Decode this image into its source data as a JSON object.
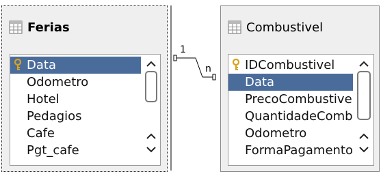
{
  "relation": {
    "cardinality_left": "1",
    "cardinality_right": "n"
  },
  "tables": [
    {
      "name": "Ferias",
      "icon": "table-icon",
      "selected_window": true,
      "fields": [
        {
          "name": "Data",
          "primary_key": true,
          "selected": true
        },
        {
          "name": "Odometro",
          "primary_key": false,
          "selected": false
        },
        {
          "name": "Hotel",
          "primary_key": false,
          "selected": false
        },
        {
          "name": "Pedagios",
          "primary_key": false,
          "selected": false
        },
        {
          "name": "Cafe",
          "primary_key": false,
          "selected": false
        },
        {
          "name": "Pgt_cafe",
          "primary_key": false,
          "selected": false
        }
      ]
    },
    {
      "name": "Combustivel",
      "icon": "table-icon",
      "selected_window": false,
      "fields": [
        {
          "name": "IDCombustivel",
          "primary_key": true,
          "selected": false
        },
        {
          "name": "Data",
          "primary_key": false,
          "selected": true
        },
        {
          "name": "PrecoCombustivel",
          "primary_key": false,
          "selected": false
        },
        {
          "name": "QuantidadeCombustivel",
          "primary_key": false,
          "selected": false
        },
        {
          "name": "Odometro",
          "primary_key": false,
          "selected": false
        },
        {
          "name": "FormaPagamento",
          "primary_key": false,
          "selected": false
        }
      ]
    }
  ],
  "colors": {
    "selection": "#4a6c9b",
    "window_bg": "#efefef",
    "key_icon": "#d8a21e"
  }
}
